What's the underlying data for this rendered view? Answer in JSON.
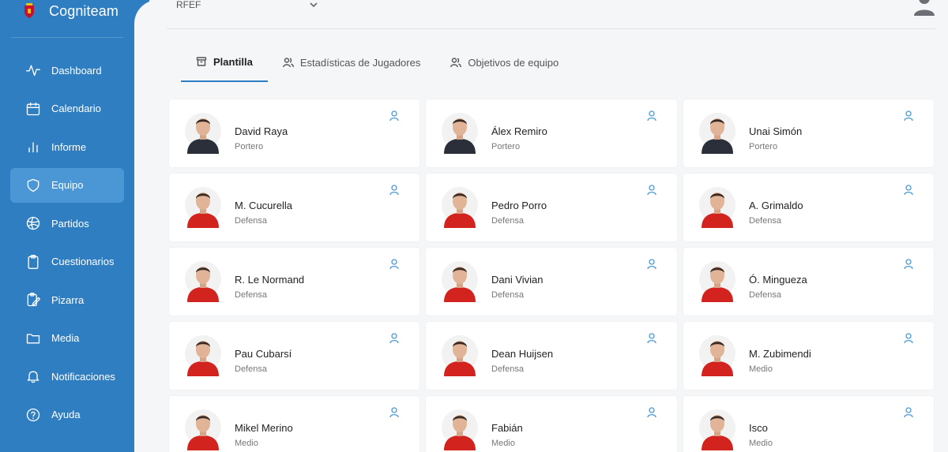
{
  "brand": {
    "name": "Cogniteam",
    "logo_icon": "crest-icon"
  },
  "header": {
    "org_selected": "RFEF"
  },
  "sidebar": {
    "items": [
      {
        "label": "Dashboard",
        "icon": "activity-icon",
        "active": false
      },
      {
        "label": "Calendario",
        "icon": "calendar-icon",
        "active": false
      },
      {
        "label": "Informe",
        "icon": "bar-chart-icon",
        "active": false
      },
      {
        "label": "Equipo",
        "icon": "shield-icon",
        "active": true
      },
      {
        "label": "Partidos",
        "icon": "ball-icon",
        "active": false
      },
      {
        "label": "Cuestionarios",
        "icon": "clipboard-icon",
        "active": false
      },
      {
        "label": "Pizarra",
        "icon": "board-edit-icon",
        "active": false
      },
      {
        "label": "Media",
        "icon": "folder-icon",
        "active": false
      },
      {
        "label": "Notificaciones",
        "icon": "bell-icon",
        "active": false
      },
      {
        "label": "Ayuda",
        "icon": "help-icon",
        "active": false
      }
    ]
  },
  "tabs": [
    {
      "label": "Plantilla",
      "icon": "archive-icon",
      "active": true
    },
    {
      "label": "Estadísticas de Jugadores",
      "icon": "users-icon",
      "active": false
    },
    {
      "label": "Objetivos de equipo",
      "icon": "users-icon",
      "active": false
    }
  ],
  "players": [
    {
      "name": "David Raya",
      "role": "Portero"
    },
    {
      "name": "Álex Remiro",
      "role": "Portero"
    },
    {
      "name": "Unai Simón",
      "role": "Portero"
    },
    {
      "name": "M. Cucurella",
      "role": "Defensa"
    },
    {
      "name": "Pedro Porro",
      "role": "Defensa"
    },
    {
      "name": "A. Grimaldo",
      "role": "Defensa"
    },
    {
      "name": "R. Le Normand",
      "role": "Defensa"
    },
    {
      "name": "Dani Vivian",
      "role": "Defensa"
    },
    {
      "name": "Ó. Mingueza",
      "role": "Defensa"
    },
    {
      "name": "Pau Cubarsí",
      "role": "Defensa"
    },
    {
      "name": "Dean Huijsen",
      "role": "Defensa"
    },
    {
      "name": "M. Zubimendi",
      "role": "Medio"
    },
    {
      "name": "Mikel Merino",
      "role": "Medio"
    },
    {
      "name": "Fabián",
      "role": "Medio"
    },
    {
      "name": "Isco",
      "role": "Medio"
    }
  ],
  "colors": {
    "sidebar_bg": "#2f7ec1",
    "sidebar_active": "#4b97d6",
    "accent": "#2f7ec1",
    "keeper_kit": "#2a2f3a",
    "field_kit": "#d3231e"
  }
}
